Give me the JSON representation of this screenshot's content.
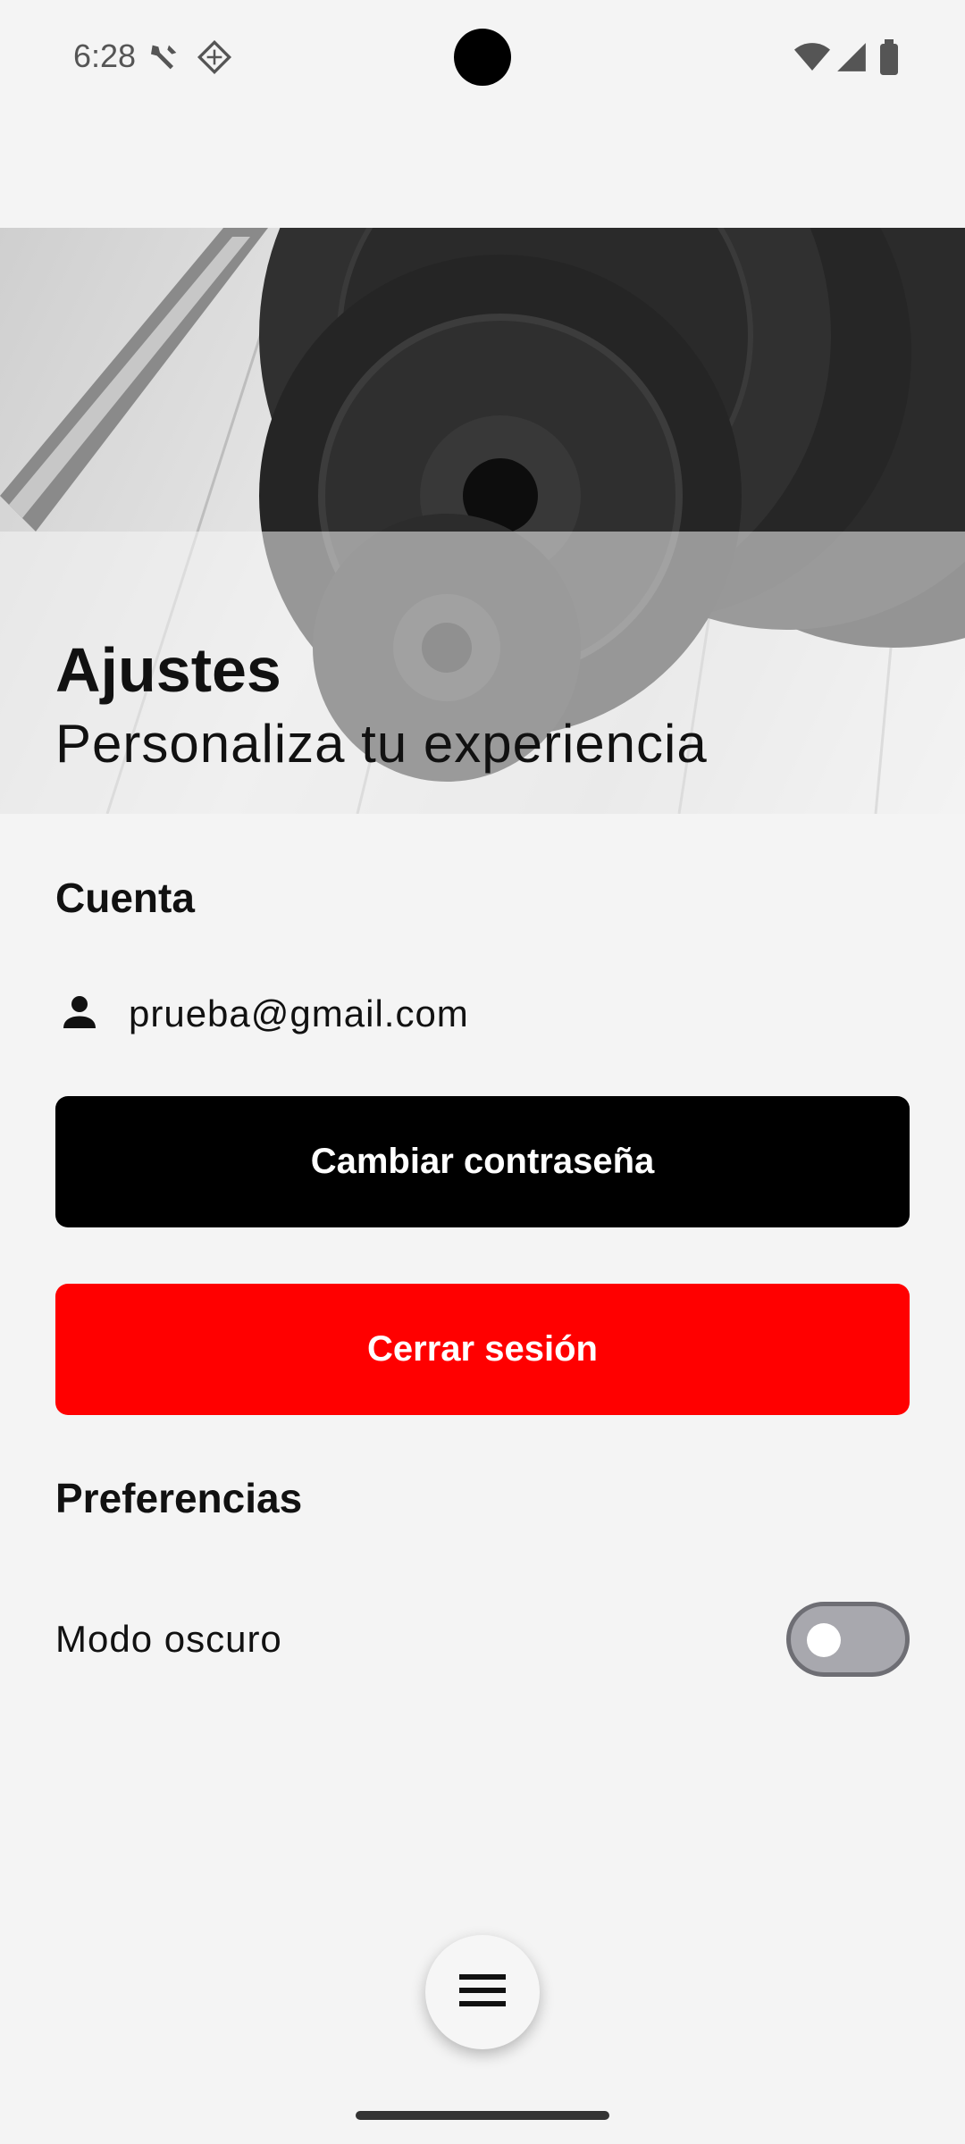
{
  "status_bar": {
    "time": "6:28",
    "icons": [
      "tools-icon",
      "diamond-grid-icon",
      "wifi-icon",
      "signal-icon",
      "battery-icon"
    ]
  },
  "header": {
    "title": "Ajustes",
    "subtitle": "Personaliza tu experiencia",
    "image": "weight-plates-photo"
  },
  "account": {
    "section_title": "Cuenta",
    "email": "prueba@gmail.com",
    "change_password_label": "Cambiar contraseña",
    "logout_label": "Cerrar sesión"
  },
  "preferences": {
    "section_title": "Preferencias",
    "dark_mode_label": "Modo oscuro",
    "dark_mode_enabled": false
  },
  "fab": {
    "icon": "menu-icon"
  },
  "colors": {
    "background": "#f4f4f4",
    "primary_button": "#000000",
    "danger_button": "#ff0000",
    "toggle_track": "#a8a8ae"
  }
}
